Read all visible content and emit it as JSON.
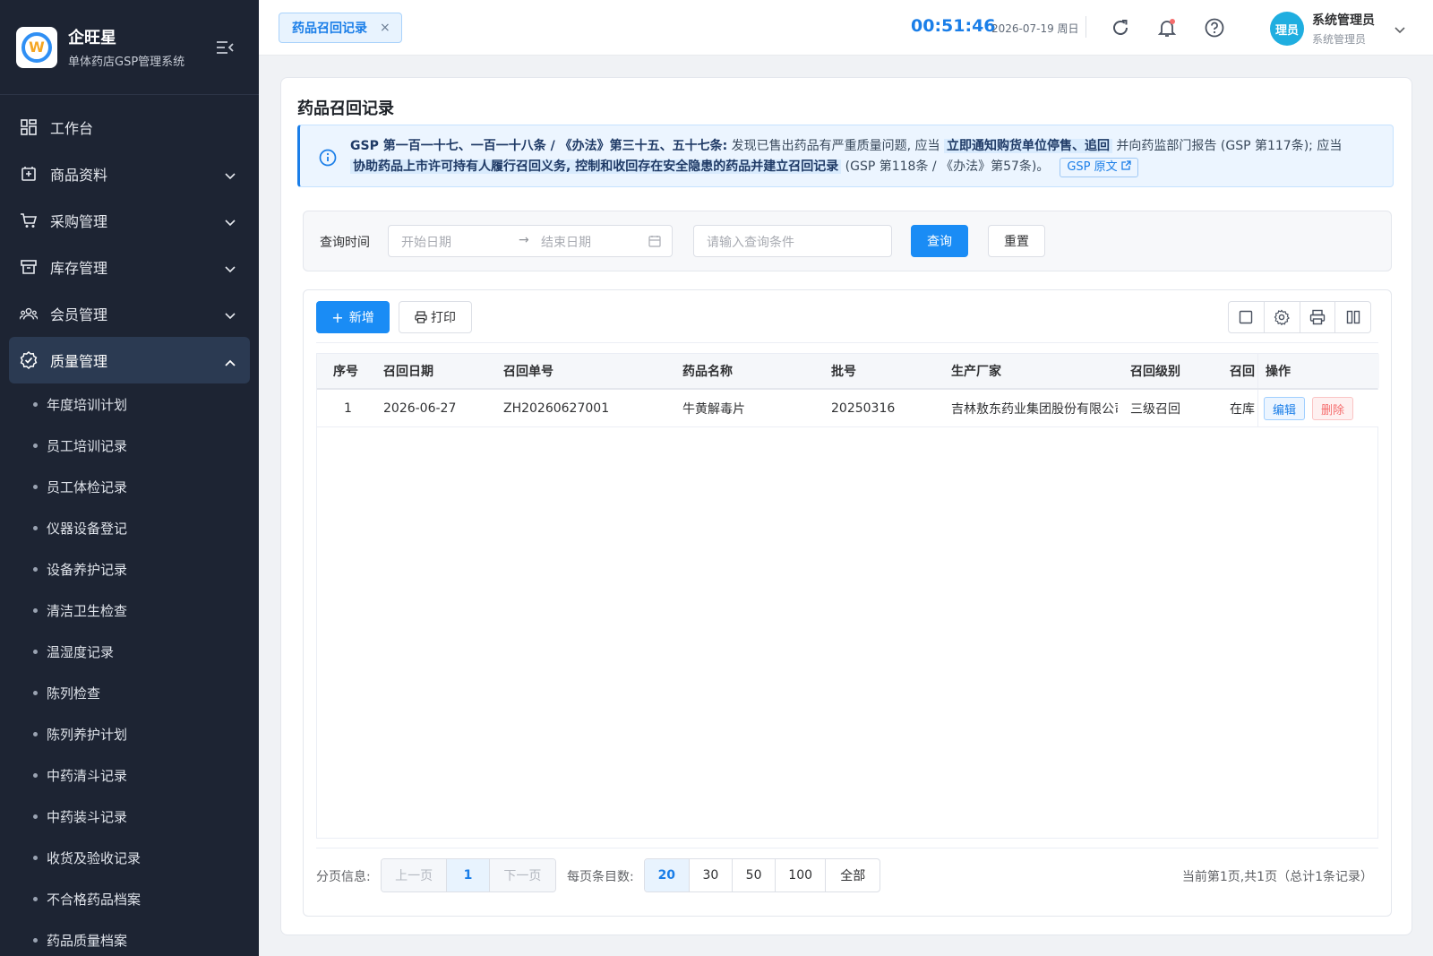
{
  "brand": {
    "title": "企旺星",
    "subtitle": "单体药店GSP管理系统",
    "logo_letter": "W"
  },
  "sidebar": {
    "items": [
      {
        "label": "工作台",
        "icon": "dashboard-icon"
      },
      {
        "label": "商品资料",
        "icon": "product-icon"
      },
      {
        "label": "采购管理",
        "icon": "cart-icon"
      },
      {
        "label": "库存管理",
        "icon": "inventory-icon"
      },
      {
        "label": "会员管理",
        "icon": "members-icon"
      },
      {
        "label": "质量管理",
        "icon": "quality-icon"
      }
    ],
    "sub_items": [
      "年度培训计划",
      "员工培训记录",
      "员工体检记录",
      "仪器设备登记",
      "设备养护记录",
      "清洁卫生检查",
      "温湿度记录",
      "陈列检查",
      "陈列养护计划",
      "中药清斗记录",
      "中药装斗记录",
      "收货及验收记录",
      "不合格药品档案",
      "药品质量档案"
    ]
  },
  "topbar": {
    "tab_label": "药品召回记录",
    "tab_close": "×",
    "clock": "00:51:46",
    "date": "2026-07-19 周日",
    "avatar_text": "理员",
    "user_name": "系统管理员",
    "user_role": "系统管理员"
  },
  "page": {
    "title": "药品召回记录",
    "notice": {
      "lead": "GSP 第一百一十七、一百一十八条 / 《办法》第三十五、五十七条:",
      "t1": " 发现已售出药品有严重质量问题, 应当 ",
      "h1": "立即通知购货单位停售、追回",
      "t2": " 并向药监部门报告 (GSP 第117条); 应当",
      "h2": "协助药品上市许可持有人履行召回义务, 控制和收回存在安全隐患的药品并建立召回记录",
      "t3": " (GSP 第118条 / 《办法》第57条)。",
      "link": "GSP 原文"
    }
  },
  "search": {
    "time_label": "查询时间",
    "start_placeholder": "开始日期",
    "arrow": "→",
    "end_placeholder": "结束日期",
    "query_placeholder": "请输入查询条件",
    "query_button": "查询",
    "reset_button": "重置"
  },
  "toolbar": {
    "add_label": "新增",
    "print_label": "打印"
  },
  "table": {
    "columns": [
      "序号",
      "召回日期",
      "召回单号",
      "药品名称",
      "批号",
      "生产厂家",
      "召回级别",
      "召回",
      "操作"
    ],
    "rows": [
      {
        "index": "1",
        "date": "2026-06-27",
        "no": "ZH20260627001",
        "drug": "牛黄解毒片",
        "batch": "20250316",
        "maker": "吉林敖东药业集团股份有限公司",
        "level": "三级召回",
        "status": "在库",
        "edit": "编辑",
        "delete": "删除"
      }
    ]
  },
  "pager": {
    "info_label": "分页信息:",
    "prev": "上一页",
    "current": "1",
    "next": "下一页",
    "size_label": "每页条目数:",
    "sizes": [
      "20",
      "30",
      "50",
      "100",
      "全部"
    ],
    "summary": "当前第1页,共1页（总计1条记录）"
  },
  "colors": {
    "primary": "#1a8cf5",
    "sidebar_bg": "#1d2433",
    "danger": "#f56c6c"
  }
}
